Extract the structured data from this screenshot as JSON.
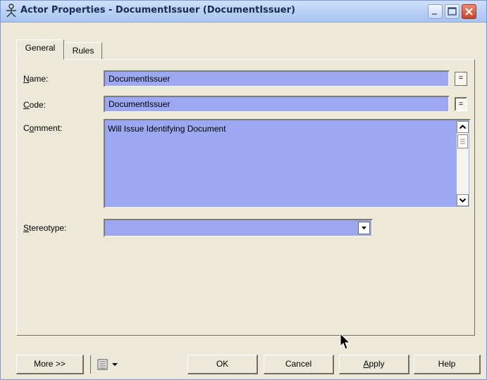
{
  "window": {
    "title": "Actor Properties - DocumentIssuer (DocumentIssuer)",
    "icon": "actor-icon"
  },
  "tabs": [
    {
      "label": "General",
      "active": true
    },
    {
      "label": "Rules",
      "active": false
    }
  ],
  "form": {
    "name": {
      "label_key": "N",
      "label_rest": "ame:",
      "value": "DocumentIssuer"
    },
    "code": {
      "label_key": "C",
      "label_rest": "ode:",
      "value": "DocumentIssuer"
    },
    "comment": {
      "label_pre": "C",
      "label_key": "o",
      "label_rest": "mment:",
      "value": "Will Issue Identifying Document"
    },
    "stereotype": {
      "label_key": "S",
      "label_rest": "tereotype:",
      "value": ""
    },
    "equals_label": "="
  },
  "buttons": {
    "more": "More >>",
    "ok": "OK",
    "cancel": "Cancel",
    "apply_key": "A",
    "apply_rest": "pply",
    "help": "Help"
  },
  "colors": {
    "field_bg": "#9ca8f2",
    "dialog_bg": "#ece9d8",
    "titlebar": "#b9d1f6"
  }
}
